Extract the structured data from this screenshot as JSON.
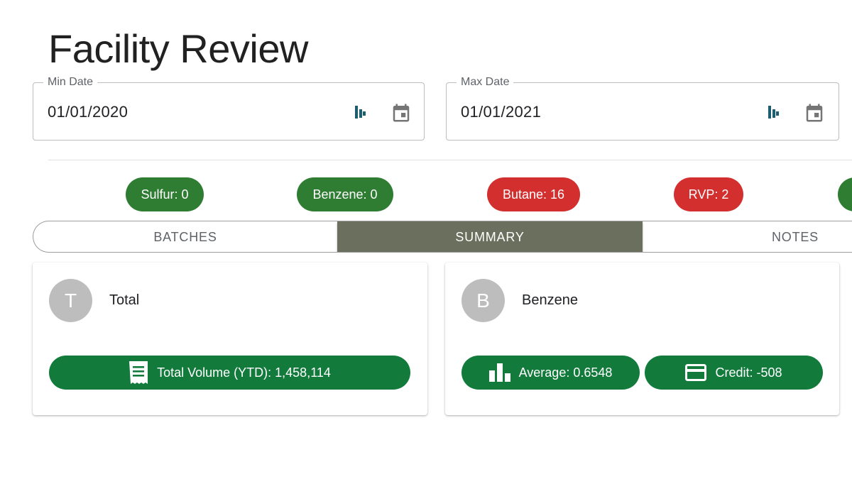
{
  "page": {
    "title": "Facility Review"
  },
  "filters": {
    "min_date": {
      "label": "Min Date",
      "value": "01/01/2020"
    },
    "max_date": {
      "label": "Max Date",
      "value": "01/01/2021"
    }
  },
  "chips": [
    {
      "label": "Sulfur: 0",
      "status": "green"
    },
    {
      "label": "Benzene: 0",
      "status": "green"
    },
    {
      "label": "Butane: 16",
      "status": "red"
    },
    {
      "label": "RVP: 2",
      "status": "red"
    },
    {
      "label": "",
      "status": "green"
    }
  ],
  "tabs": {
    "batches": "BATCHES",
    "summary": "SUMMARY",
    "notes": "NOTES",
    "active": "SUMMARY"
  },
  "cards": {
    "total": {
      "avatar_letter": "T",
      "title": "Total",
      "stat_icon": "receipt-icon",
      "stat": "Total Volume (YTD): 1,458,114"
    },
    "benzene": {
      "avatar_letter": "B",
      "title": "Benzene",
      "average_icon": "bar-chart-icon",
      "average": "Average: 0.6548",
      "credit_icon": "credit-card-icon",
      "credit": "Credit: -508"
    }
  },
  "colors": {
    "chip_green": "#2e7d32",
    "chip_red": "#d32f2f",
    "active_tab": "#6b6f5e",
    "stat_pill": "#127b3c",
    "avatar": "#bdbdbd"
  }
}
